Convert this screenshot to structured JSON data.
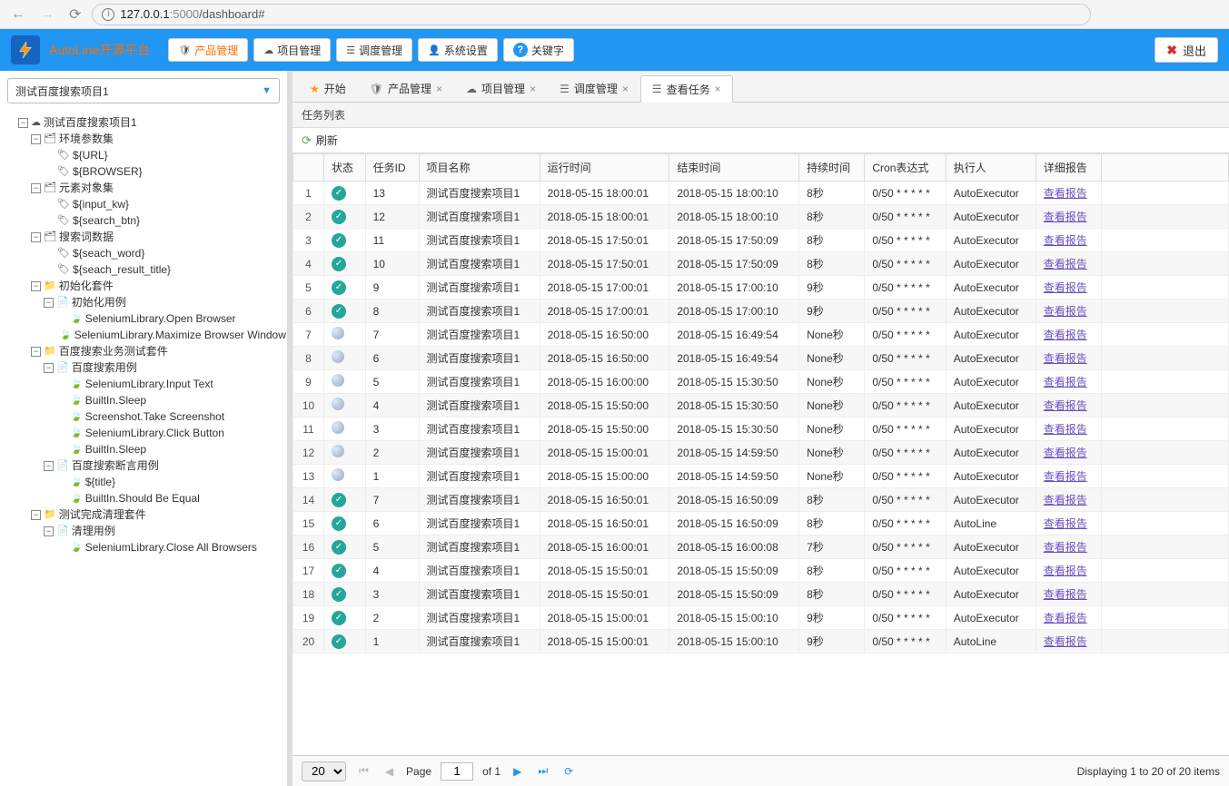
{
  "browser": {
    "url_host": "127.0.0.1",
    "url_port": ":5000",
    "url_path": "/dashboard#"
  },
  "app": {
    "title": "AutoLine开源平台"
  },
  "toolbar": {
    "product": "产品管理",
    "project": "项目管理",
    "schedule": "调度管理",
    "system": "系统设置",
    "keyword": "关键字",
    "logout": "退出"
  },
  "sidebar": {
    "combo_value": "测试百度搜索项目1",
    "nodes": {
      "root": "测试百度搜索项目1",
      "env": "环境参数集",
      "url": "${URL}",
      "browser": "${BROWSER}",
      "elem": "元素对象集",
      "input_kw": "${input_kw}",
      "search_btn": "${search_btn}",
      "search_words": "搜索词数据",
      "seach_word": "${seach_word}",
      "seach_result_title": "${seach_result_title}",
      "init_suite": "初始化套件",
      "init_case": "初始化用例",
      "kw_open": "SeleniumLibrary.Open Browser",
      "kw_max": "SeleniumLibrary.Maximize Browser Window",
      "biz_suite": "百度搜索业务测试套件",
      "biz_case": "百度搜索用例",
      "kw_input": "SeleniumLibrary.Input Text",
      "kw_sleep": "BuiltIn.Sleep",
      "kw_shot": "Screenshot.Take Screenshot",
      "kw_click": "SeleniumLibrary.Click Button",
      "kw_sleep2": "BuiltIn.Sleep",
      "assert_case": "百度搜索断言用例",
      "title_var": "${title}",
      "kw_eq": "BuiltIn.Should Be Equal",
      "clean_suite": "测试完成清理套件",
      "clean_case": "清理用例",
      "kw_close": "SeleniumLibrary.Close All Browsers"
    }
  },
  "tabs": {
    "start": "开始",
    "product": "产品管理",
    "project": "项目管理",
    "schedule": "调度管理",
    "view_task": "查看任务"
  },
  "panel": {
    "title": "任务列表",
    "refresh": "刷新"
  },
  "columns": {
    "status": "状态",
    "task_id": "任务ID",
    "project": "项目名称",
    "run_time": "运行时间",
    "end_time": "结束时间",
    "duration": "持续时间",
    "cron": "Cron表达式",
    "executor": "执行人",
    "report": "详细报告"
  },
  "report_link_label": "查看报告",
  "rows": [
    {
      "n": 1,
      "s": "ok",
      "id": 13,
      "p": "测试百度搜索项目1",
      "rt": "2018-05-15 18:00:01",
      "et": "2018-05-15 18:00:10",
      "d": "8秒",
      "c": "0/50 * * * * *",
      "ex": "AutoExecutor"
    },
    {
      "n": 2,
      "s": "ok",
      "id": 12,
      "p": "测试百度搜索项目1",
      "rt": "2018-05-15 18:00:01",
      "et": "2018-05-15 18:00:10",
      "d": "8秒",
      "c": "0/50 * * * * *",
      "ex": "AutoExecutor"
    },
    {
      "n": 3,
      "s": "ok",
      "id": 11,
      "p": "测试百度搜索项目1",
      "rt": "2018-05-15 17:50:01",
      "et": "2018-05-15 17:50:09",
      "d": "8秒",
      "c": "0/50 * * * * *",
      "ex": "AutoExecutor"
    },
    {
      "n": 4,
      "s": "ok",
      "id": 10,
      "p": "测试百度搜索项目1",
      "rt": "2018-05-15 17:50:01",
      "et": "2018-05-15 17:50:09",
      "d": "8秒",
      "c": "0/50 * * * * *",
      "ex": "AutoExecutor"
    },
    {
      "n": 5,
      "s": "ok",
      "id": 9,
      "p": "测试百度搜索项目1",
      "rt": "2018-05-15 17:00:01",
      "et": "2018-05-15 17:00:10",
      "d": "9秒",
      "c": "0/50 * * * * *",
      "ex": "AutoExecutor"
    },
    {
      "n": 6,
      "s": "ok",
      "id": 8,
      "p": "测试百度搜索项目1",
      "rt": "2018-05-15 17:00:01",
      "et": "2018-05-15 17:00:10",
      "d": "9秒",
      "c": "0/50 * * * * *",
      "ex": "AutoExecutor"
    },
    {
      "n": 7,
      "s": "none",
      "id": 7,
      "p": "测试百度搜索项目1",
      "rt": "2018-05-15 16:50:00",
      "et": "2018-05-15 16:49:54",
      "d": "None秒",
      "c": "0/50 * * * * *",
      "ex": "AutoExecutor"
    },
    {
      "n": 8,
      "s": "none",
      "id": 6,
      "p": "测试百度搜索项目1",
      "rt": "2018-05-15 16:50:00",
      "et": "2018-05-15 16:49:54",
      "d": "None秒",
      "c": "0/50 * * * * *",
      "ex": "AutoExecutor"
    },
    {
      "n": 9,
      "s": "none",
      "id": 5,
      "p": "测试百度搜索项目1",
      "rt": "2018-05-15 16:00:00",
      "et": "2018-05-15 15:30:50",
      "d": "None秒",
      "c": "0/50 * * * * *",
      "ex": "AutoExecutor"
    },
    {
      "n": 10,
      "s": "none",
      "id": 4,
      "p": "测试百度搜索项目1",
      "rt": "2018-05-15 15:50:00",
      "et": "2018-05-15 15:30:50",
      "d": "None秒",
      "c": "0/50 * * * * *",
      "ex": "AutoExecutor"
    },
    {
      "n": 11,
      "s": "none",
      "id": 3,
      "p": "测试百度搜索项目1",
      "rt": "2018-05-15 15:50:00",
      "et": "2018-05-15 15:30:50",
      "d": "None秒",
      "c": "0/50 * * * * *",
      "ex": "AutoExecutor"
    },
    {
      "n": 12,
      "s": "none",
      "id": 2,
      "p": "测试百度搜索项目1",
      "rt": "2018-05-15 15:00:01",
      "et": "2018-05-15 14:59:50",
      "d": "None秒",
      "c": "0/50 * * * * *",
      "ex": "AutoExecutor"
    },
    {
      "n": 13,
      "s": "none",
      "id": 1,
      "p": "测试百度搜索项目1",
      "rt": "2018-05-15 15:00:00",
      "et": "2018-05-15 14:59:50",
      "d": "None秒",
      "c": "0/50 * * * * *",
      "ex": "AutoExecutor"
    },
    {
      "n": 14,
      "s": "ok",
      "id": 7,
      "p": "测试百度搜索项目1",
      "rt": "2018-05-15 16:50:01",
      "et": "2018-05-15 16:50:09",
      "d": "8秒",
      "c": "0/50 * * * * *",
      "ex": "AutoExecutor"
    },
    {
      "n": 15,
      "s": "ok",
      "id": 6,
      "p": "测试百度搜索项目1",
      "rt": "2018-05-15 16:50:01",
      "et": "2018-05-15 16:50:09",
      "d": "8秒",
      "c": "0/50 * * * * *",
      "ex": "AutoLine"
    },
    {
      "n": 16,
      "s": "ok",
      "id": 5,
      "p": "测试百度搜索项目1",
      "rt": "2018-05-15 16:00:01",
      "et": "2018-05-15 16:00:08",
      "d": "7秒",
      "c": "0/50 * * * * *",
      "ex": "AutoExecutor"
    },
    {
      "n": 17,
      "s": "ok",
      "id": 4,
      "p": "测试百度搜索项目1",
      "rt": "2018-05-15 15:50:01",
      "et": "2018-05-15 15:50:09",
      "d": "8秒",
      "c": "0/50 * * * * *",
      "ex": "AutoExecutor"
    },
    {
      "n": 18,
      "s": "ok",
      "id": 3,
      "p": "测试百度搜索项目1",
      "rt": "2018-05-15 15:50:01",
      "et": "2018-05-15 15:50:09",
      "d": "8秒",
      "c": "0/50 * * * * *",
      "ex": "AutoExecutor"
    },
    {
      "n": 19,
      "s": "ok",
      "id": 2,
      "p": "测试百度搜索项目1",
      "rt": "2018-05-15 15:00:01",
      "et": "2018-05-15 15:00:10",
      "d": "9秒",
      "c": "0/50 * * * * *",
      "ex": "AutoExecutor"
    },
    {
      "n": 20,
      "s": "ok",
      "id": 1,
      "p": "测试百度搜索项目1",
      "rt": "2018-05-15 15:00:01",
      "et": "2018-05-15 15:00:10",
      "d": "9秒",
      "c": "0/50 * * * * *",
      "ex": "AutoLine"
    }
  ],
  "pager": {
    "page_size": "20",
    "page_label": "Page",
    "page_value": "1",
    "of_label": "of 1",
    "display": "Displaying 1 to 20 of 20 items"
  }
}
